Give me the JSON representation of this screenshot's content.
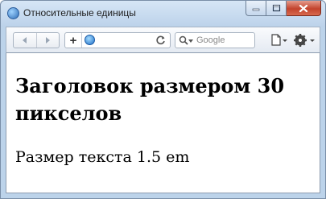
{
  "window": {
    "title": "Относительные единицы"
  },
  "toolbar": {
    "search_placeholder": "Google"
  },
  "page": {
    "heading": "Заголовок размером 30 пикселов",
    "paragraph": "Размер текста 1.5 em"
  }
}
